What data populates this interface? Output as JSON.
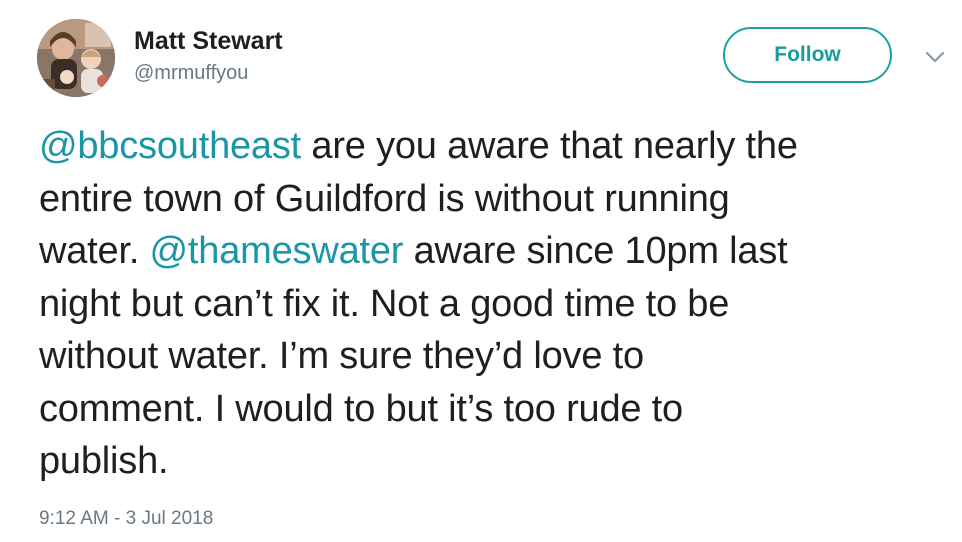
{
  "author": {
    "name": "Matt Stewart",
    "handle": "@mrmuffyou",
    "avatar_icon": "profile-photo"
  },
  "actions": {
    "follow_label": "Follow",
    "menu_icon": "chevron-down-icon"
  },
  "tweet": {
    "lines": [
      [
        {
          "type": "mention",
          "text": "@bbcsoutheast"
        },
        {
          "type": "text",
          "text": " are you aware that nearly the"
        }
      ],
      [
        {
          "type": "text",
          "text": "entire town of Guildford is without running"
        }
      ],
      [
        {
          "type": "text",
          "text": "water. "
        },
        {
          "type": "mention",
          "text": "@thameswater"
        },
        {
          "type": "text",
          "text": " aware since 10pm last"
        }
      ],
      [
        {
          "type": "text",
          "text": "night but can’t fix it. Not a good time to be"
        }
      ],
      [
        {
          "type": "text",
          "text": "without water. I’m sure they’d love to"
        }
      ],
      [
        {
          "type": "text",
          "text": "comment. I would to but it’s too rude to"
        }
      ],
      [
        {
          "type": "text",
          "text": "publish."
        }
      ]
    ],
    "timestamp": "9:12 AM - 3 Jul 2018"
  },
  "colors": {
    "accent": "#1b95a8",
    "follow_border": "#1da0a0",
    "text": "#1c2022",
    "muted": "#697882"
  }
}
